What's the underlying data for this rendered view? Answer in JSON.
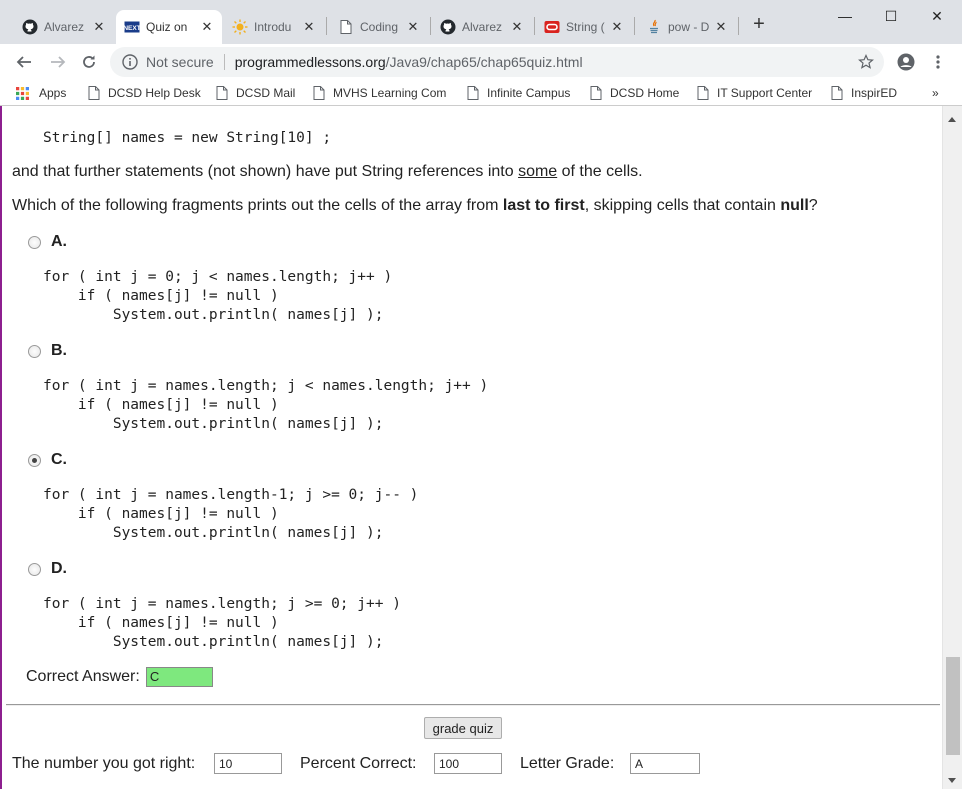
{
  "tabs": [
    {
      "title": "Alvarez",
      "icon": "github-icon",
      "active": false
    },
    {
      "title": "Quiz on",
      "icon": "next-icon",
      "active": true
    },
    {
      "title": "Introdu",
      "icon": "sun-icon",
      "active": false
    },
    {
      "title": "Coding",
      "icon": "page-icon",
      "active": false
    },
    {
      "title": "Alvarez",
      "icon": "github-icon",
      "active": false
    },
    {
      "title": "String (",
      "icon": "oracle-icon",
      "active": false
    },
    {
      "title": "pow - D",
      "icon": "java-icon",
      "active": false
    }
  ],
  "window": {
    "minimize": "—",
    "maximize": "☐",
    "close": "✕"
  },
  "address": {
    "security_label": "Not secure",
    "host": "programmedlessons.org",
    "path": "/Java9/chap65/chap65quiz.html"
  },
  "bookmarks": [
    {
      "label": "Apps",
      "icon": "apps-grid-icon"
    },
    {
      "label": "DCSD Help Desk",
      "icon": "page-icon"
    },
    {
      "label": "DCSD Mail",
      "icon": "page-icon"
    },
    {
      "label": "MVHS Learning Com",
      "icon": "page-icon"
    },
    {
      "label": "Infinite Campus",
      "icon": "page-icon"
    },
    {
      "label": "DCSD Home",
      "icon": "page-icon"
    },
    {
      "label": "IT Support Center",
      "icon": "page-icon"
    },
    {
      "label": "InspirED",
      "icon": "page-icon"
    }
  ],
  "bookmarks_more": "»",
  "content": {
    "declaration": "String[] names = new String[10] ;",
    "para1": {
      "before": "and that further statements (not shown) have put String references into ",
      "emphasis": "some",
      "after": " of the cells."
    },
    "question": {
      "before": "Which of the following fragments prints out the cells of the array from ",
      "bold1": "last to first",
      "middle": ", skipping cells that contain ",
      "bold2": "null",
      "after": "?"
    },
    "options": [
      {
        "letter": "A.",
        "checked": false,
        "code": "for ( int j = 0; j < names.length; j++ )\n    if ( names[j] != null )\n        System.out.println( names[j] );"
      },
      {
        "letter": "B.",
        "checked": false,
        "code": "for ( int j = names.length; j < names.length; j++ )\n    if ( names[j] != null )\n        System.out.println( names[j] );"
      },
      {
        "letter": "C.",
        "checked": true,
        "code": "for ( int j = names.length-1; j >= 0; j-- )\n    if ( names[j] != null )\n        System.out.println( names[j] );"
      },
      {
        "letter": "D.",
        "checked": false,
        "code": "for ( int j = names.length; j >= 0; j++ )\n    if ( names[j] != null )\n        System.out.println( names[j] );"
      }
    ],
    "correct_answer_label": "Correct Answer:",
    "correct_answer_value": "C",
    "grade_button": "grade quiz",
    "score": {
      "right_label": "The number you got right:",
      "right_value": "10",
      "percent_label": "Percent Correct:",
      "percent_value": "100",
      "grade_label": "Letter Grade:",
      "grade_value": "A"
    }
  },
  "colors": {
    "page_border": "#8d1f8f",
    "answer_bg": "#7ee87e",
    "tabstrip_bg": "#dee1e6"
  }
}
